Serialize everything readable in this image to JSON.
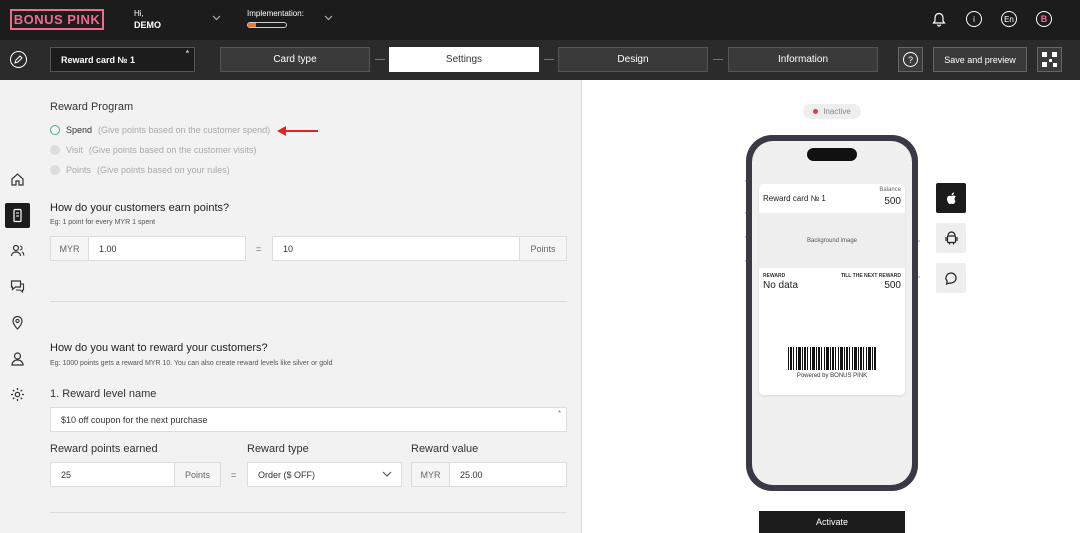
{
  "header": {
    "logo_text": "BONUS PINK",
    "greeting": "Hi,",
    "user_name": "DEMO",
    "implementation_label": "Implementation:",
    "implementation_progress": 0.2,
    "language": "En",
    "avatar_initial": "B"
  },
  "stepbar": {
    "card_name": "Reward card № 1",
    "card_name_required": "*",
    "steps": [
      "Card type",
      "Settings",
      "Design",
      "Information"
    ],
    "active_step": "Settings",
    "help_icon": "?",
    "save_label": "Save and preview"
  },
  "sidebar": {
    "icons": [
      "home-icon",
      "card-icon",
      "users-icon",
      "chat-icon",
      "location-icon",
      "account-icon",
      "gear-icon"
    ]
  },
  "form": {
    "reward_program_title": "Reward Program",
    "options": [
      {
        "label": "Spend",
        "hint": "(Give points based on the customer spend)",
        "selected": true
      },
      {
        "label": "Visit",
        "hint": "(Give points based on the customer visits)",
        "selected": false
      },
      {
        "label": "Points",
        "hint": "(Give points based on your rules)",
        "selected": false
      }
    ],
    "earn_title": "How do your customers earn points?",
    "earn_hint": "Eg: 1 point for every MYR 1 spent",
    "currency": "MYR",
    "spend_amount": "1.00",
    "equals": "=",
    "points_amount": "10",
    "points_unit": "Points",
    "reward_title": "How do you want to reward your customers?",
    "reward_hint": "Eg: 1000 points gets a reward MYR 10. You can also create reward levels like silver or gold",
    "level_name_label": "1. Reward level name",
    "level_name_value": "$10 off coupon for the next purchase",
    "level_name_required": "*",
    "points_earned_label": "Reward points earned",
    "points_earned_value": "25",
    "points_earned_unit": "Points",
    "reward_type_label": "Reward type",
    "reward_type_value": "Order ($ OFF)",
    "reward_value_label": "Reward value",
    "reward_value_currency": "MYR",
    "reward_value_amount": "25.00"
  },
  "preview": {
    "status": "Inactive",
    "status_color": "#e23b3b",
    "pass_title": "Reward card № 1",
    "balance_label": "Balance",
    "balance_value": "500",
    "background_label": "Background image",
    "reward_label": "REWARD",
    "reward_value": "No data",
    "next_reward_label": "TILL THE NEXT REWARD",
    "next_reward_value": "500",
    "powered_by": "Powered by BONUS PINK",
    "platforms": [
      "apple-icon",
      "android-icon",
      "chat-bubble-icon"
    ],
    "activate_label": "Activate"
  },
  "colors": {
    "brand": "#f06b8c",
    "dark": "#1c1c1c",
    "selected_radio": "#3cb371",
    "arrow": "#e02424"
  }
}
